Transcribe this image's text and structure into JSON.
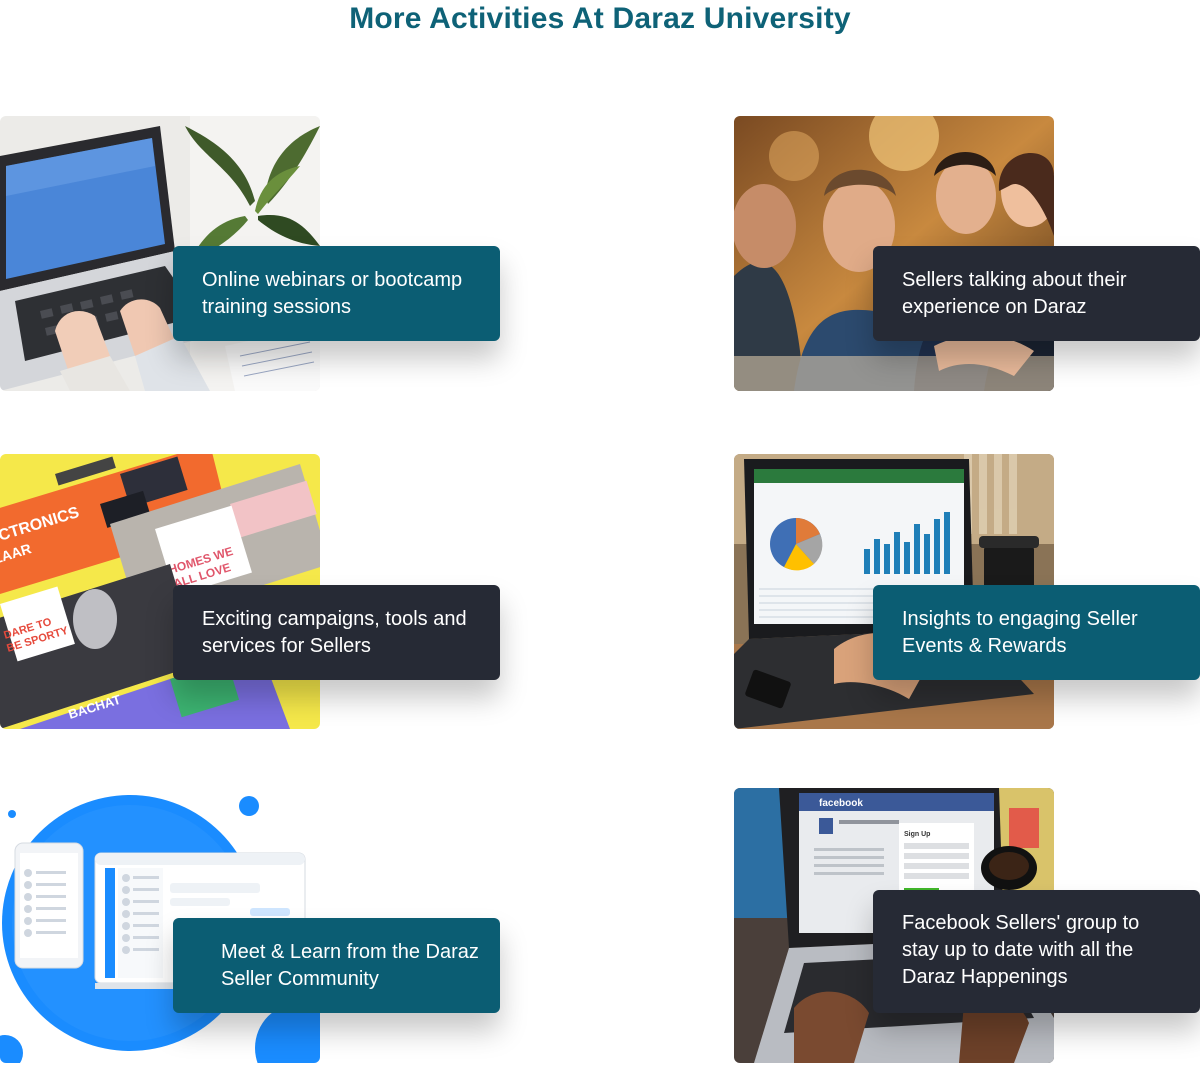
{
  "page": {
    "title": "More Activities At Daraz University"
  },
  "colors": {
    "title": "#0e6277",
    "caption_teal": "#0b5d73",
    "caption_dark": "#262a35"
  },
  "activities": [
    {
      "caption": "Online webinars or bootcamp training sessions",
      "image": "laptop-typing-photo",
      "style": "teal"
    },
    {
      "caption": "Sellers talking about their experience on Daraz",
      "image": "sellers-group-photo",
      "style": "dark"
    },
    {
      "caption": "Exciting campaigns, tools and services for Sellers",
      "image": "campaign-banners-image",
      "style": "dark"
    },
    {
      "caption": "Insights to engaging Seller Events & Rewards",
      "image": "analytics-laptop-photo",
      "style": "teal"
    },
    {
      "caption": "Meet & Learn from the Daraz  Seller Community",
      "image": "chat-app-illustration",
      "style": "teal"
    },
    {
      "caption": "Facebook Sellers' group to stay up to date with all the Daraz Happenings",
      "image": "facebook-laptop-photo",
      "style": "dark"
    }
  ]
}
